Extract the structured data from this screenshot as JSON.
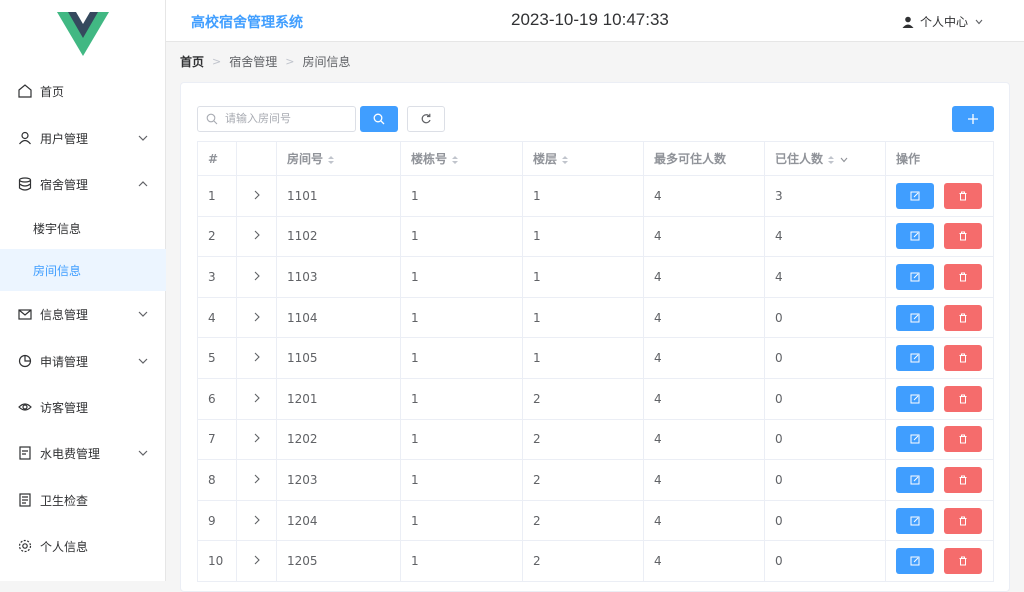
{
  "app": {
    "title": "高校宿舍管理系统",
    "clock": "2023-10-19 10:47:33",
    "user_center": "个人中心"
  },
  "sidebar": {
    "items": [
      {
        "label": "首页",
        "icon": "home-icon"
      },
      {
        "label": "用户管理",
        "icon": "user-icon"
      },
      {
        "label": "宿舍管理",
        "icon": "database-icon"
      },
      {
        "label": "信息管理",
        "icon": "message-icon"
      },
      {
        "label": "申请管理",
        "icon": "pie-chart-icon"
      },
      {
        "label": "访客管理",
        "icon": "eye-icon"
      },
      {
        "label": "水电费管理",
        "icon": "bill-icon"
      },
      {
        "label": "卫生检查",
        "icon": "document-icon"
      },
      {
        "label": "个人信息",
        "icon": "gear-icon"
      }
    ],
    "subitems": [
      "楼宇信息",
      "房间信息"
    ]
  },
  "breadcrumb": [
    "首页",
    "宿舍管理",
    "房间信息"
  ],
  "search": {
    "placeholder": "请输入房间号"
  },
  "table": {
    "headers": [
      "#",
      "",
      "房间号",
      "楼栋号",
      "楼层",
      "最多可住人数",
      "已住人数",
      "操作"
    ],
    "rows": [
      [
        "1",
        "1101",
        "1",
        "1",
        "4",
        "3"
      ],
      [
        "2",
        "1102",
        "1",
        "1",
        "4",
        "4"
      ],
      [
        "3",
        "1103",
        "1",
        "1",
        "4",
        "4"
      ],
      [
        "4",
        "1104",
        "1",
        "1",
        "4",
        "0"
      ],
      [
        "5",
        "1105",
        "1",
        "1",
        "4",
        "0"
      ],
      [
        "6",
        "1201",
        "1",
        "2",
        "4",
        "0"
      ],
      [
        "7",
        "1202",
        "1",
        "2",
        "4",
        "0"
      ],
      [
        "8",
        "1203",
        "1",
        "2",
        "4",
        "0"
      ],
      [
        "9",
        "1204",
        "1",
        "2",
        "4",
        "0"
      ],
      [
        "10",
        "1205",
        "1",
        "2",
        "4",
        "0"
      ]
    ]
  },
  "colors": {
    "primary": "#409eff",
    "danger": "#f56c6c",
    "logo_green": "#41b883",
    "logo_dark": "#35495e"
  }
}
